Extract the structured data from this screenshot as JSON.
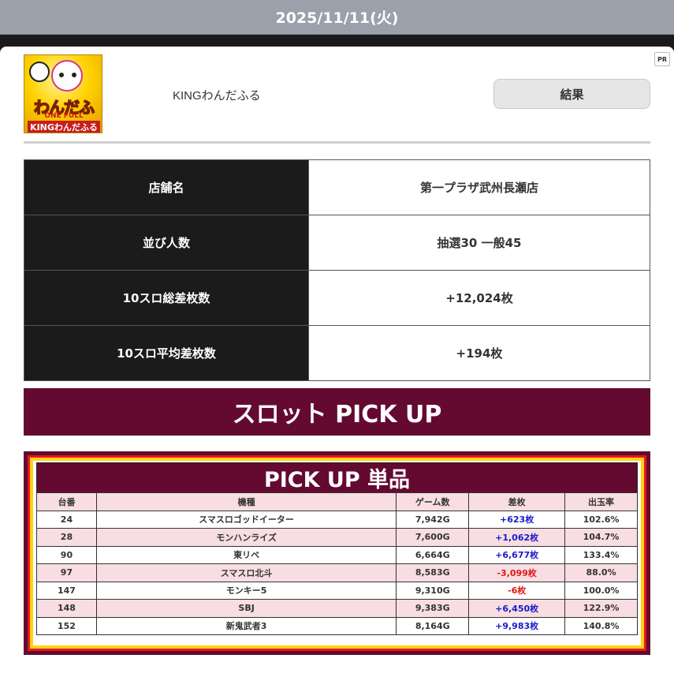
{
  "date": "2025/11/11(火)",
  "pr_badge": "PR",
  "logo": {
    "line1": "わんだふる",
    "line2": "ONE FULL",
    "line3": "KINGわんだふる"
  },
  "machine_name": "KINGわんだふる",
  "result_button": "結果",
  "info": [
    {
      "label": "店舗名",
      "value": "第一プラザ武州長瀬店"
    },
    {
      "label": "並び人数",
      "value": "抽選30 一般45"
    },
    {
      "label": "10スロ総差枚数",
      "value": "+12,024枚"
    },
    {
      "label": "10スロ平均差枚数",
      "value": "+194枚"
    }
  ],
  "pickup_banner": "スロット PICK UP",
  "pickup_single": {
    "title": "PICK UP 単品",
    "headers": [
      "台番",
      "機種",
      "ゲーム数",
      "差枚",
      "出玉率"
    ],
    "rows": [
      {
        "no": "24",
        "model": "スマスロゴッドイーター",
        "games": "7,942G",
        "diff": "+623枚",
        "rate": "102.6%"
      },
      {
        "no": "28",
        "model": "モンハンライズ",
        "games": "7,600G",
        "diff": "+1,062枚",
        "rate": "104.7%"
      },
      {
        "no": "90",
        "model": "東リベ",
        "games": "6,664G",
        "diff": "+6,677枚",
        "rate": "133.4%"
      },
      {
        "no": "97",
        "model": "スマスロ北斗",
        "games": "8,583G",
        "diff": "-3,099枚",
        "rate": "88.0%"
      },
      {
        "no": "147",
        "model": "モンキー5",
        "games": "9,310G",
        "diff": "-6枚",
        "rate": "100.0%"
      },
      {
        "no": "148",
        "model": "SBJ",
        "games": "9,383G",
        "diff": "+6,450枚",
        "rate": "122.9%"
      },
      {
        "no": "152",
        "model": "新鬼武者3",
        "games": "8,164G",
        "diff": "+9,983枚",
        "rate": "140.8%"
      }
    ]
  },
  "colors": {
    "positive": "#1a1ac8",
    "negative": "#e01818",
    "banner": "#640a30"
  }
}
